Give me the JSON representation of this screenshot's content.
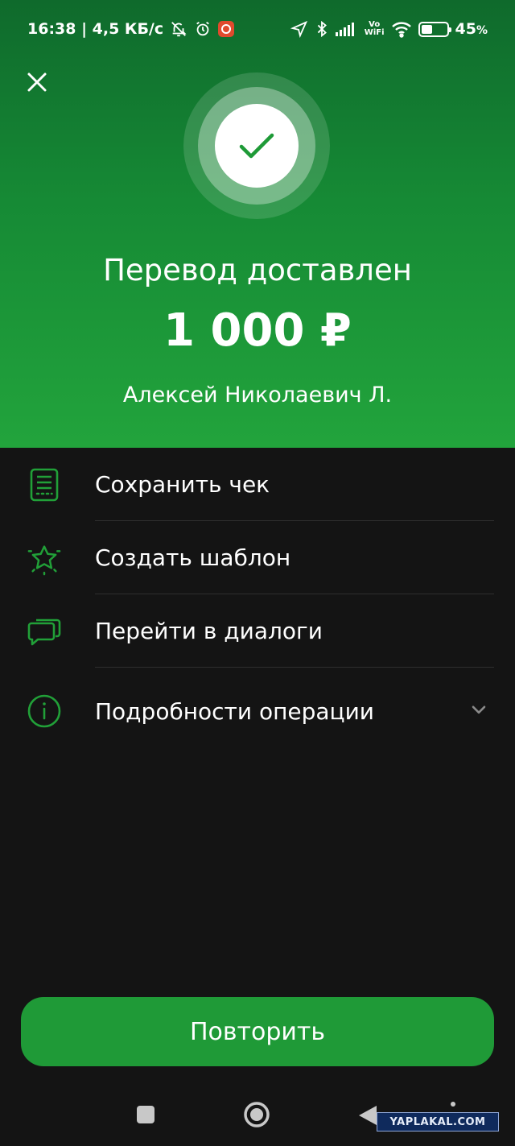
{
  "status_bar": {
    "time_speed": "16:38 | 4,5 КБ/с",
    "vowifi_top": "Vo",
    "vowifi_bottom": "WiFi",
    "battery_percent": "45",
    "battery_percent_sign": "%",
    "battery_level": 0.45
  },
  "hero": {
    "title": "Перевод доставлен",
    "amount": "1 000 ₽",
    "recipient": "Алексей Николаевич Л."
  },
  "actions": [
    {
      "label": "Сохранить чек",
      "icon": "receipt-icon"
    },
    {
      "label": "Создать шаблон",
      "icon": "star-icon"
    },
    {
      "label": "Перейти в диалоги",
      "icon": "chat-icon"
    },
    {
      "label": "Подробности операции",
      "icon": "info-icon"
    }
  ],
  "repeat_button": "Повторить",
  "watermark": "YAPLAKAL.COM",
  "colors": {
    "accent": "#21a038",
    "hero_dark": "#0f6a2c",
    "hero_light": "#22a43c",
    "background": "#141414",
    "button": "#1f9a37"
  }
}
